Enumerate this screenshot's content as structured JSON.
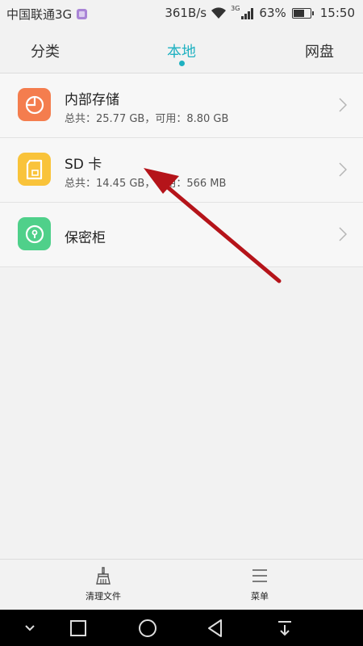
{
  "status_bar": {
    "carrier": "中国联通3G",
    "speed": "361B/s",
    "net_tag": "3G",
    "battery": "63%",
    "time": "15:50"
  },
  "tabs": [
    {
      "label": "分类"
    },
    {
      "label": "本地",
      "selected": true
    },
    {
      "label": "网盘"
    }
  ],
  "storage": [
    {
      "title": "内部存储",
      "subtitle": "总共：25.77 GB，可用：8.80 GB",
      "icon": "pie-chart-icon",
      "color": "#f47d4e"
    },
    {
      "title": "SD 卡",
      "subtitle": "总共：14.45 GB，可用：566 MB",
      "icon": "sd-card-icon",
      "color": "#f9c33a"
    },
    {
      "title": "保密柜",
      "icon": "lock-icon",
      "color": "#4fd08a"
    }
  ],
  "toolbar": {
    "clean_label": "清理文件",
    "menu_label": "菜单"
  },
  "colors": {
    "accent": "#1fb1c1",
    "annotation_arrow": "#b5141a"
  }
}
